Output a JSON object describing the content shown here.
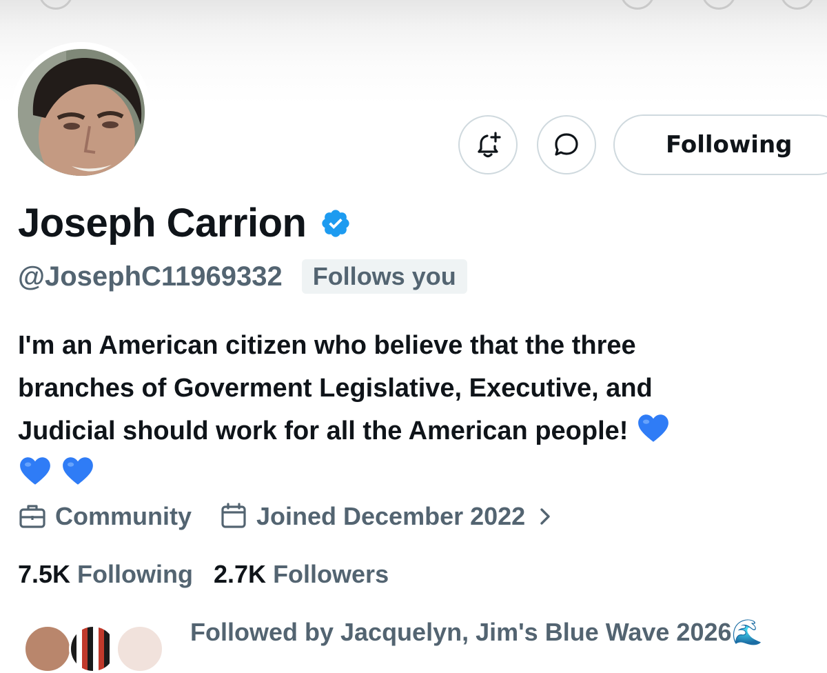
{
  "profile": {
    "name": "Joseph Carrion",
    "handle": "@JosephC11969332",
    "follows_you_badge": "Follows you",
    "bio_line1": "I'm an American citizen who believe that the three",
    "bio_line2": "branches of Goverment Legislative, Executive, and",
    "bio_line3": "Judicial should work for all the American people!",
    "bio_emoji": "blue-heart",
    "category": "Community",
    "joined": "Joined December 2022",
    "following_count": "7.5K",
    "following_label": "Following",
    "followers_count": "2.7K",
    "followers_label": "Followers",
    "followed_by_text": "Followed by Jacquelyn, Jim's Blue Wave 2026🌊"
  },
  "actions": {
    "following_button_label": "Following",
    "notify_icon": "bell-plus-icon",
    "message_icon": "speech-bubble-icon"
  },
  "colors": {
    "primary_text": "#0f1419",
    "secondary_text": "#536471",
    "verified_blue": "#1d9bf0",
    "heart_blue": "#2f7cf6",
    "border": "#cfd9de"
  }
}
